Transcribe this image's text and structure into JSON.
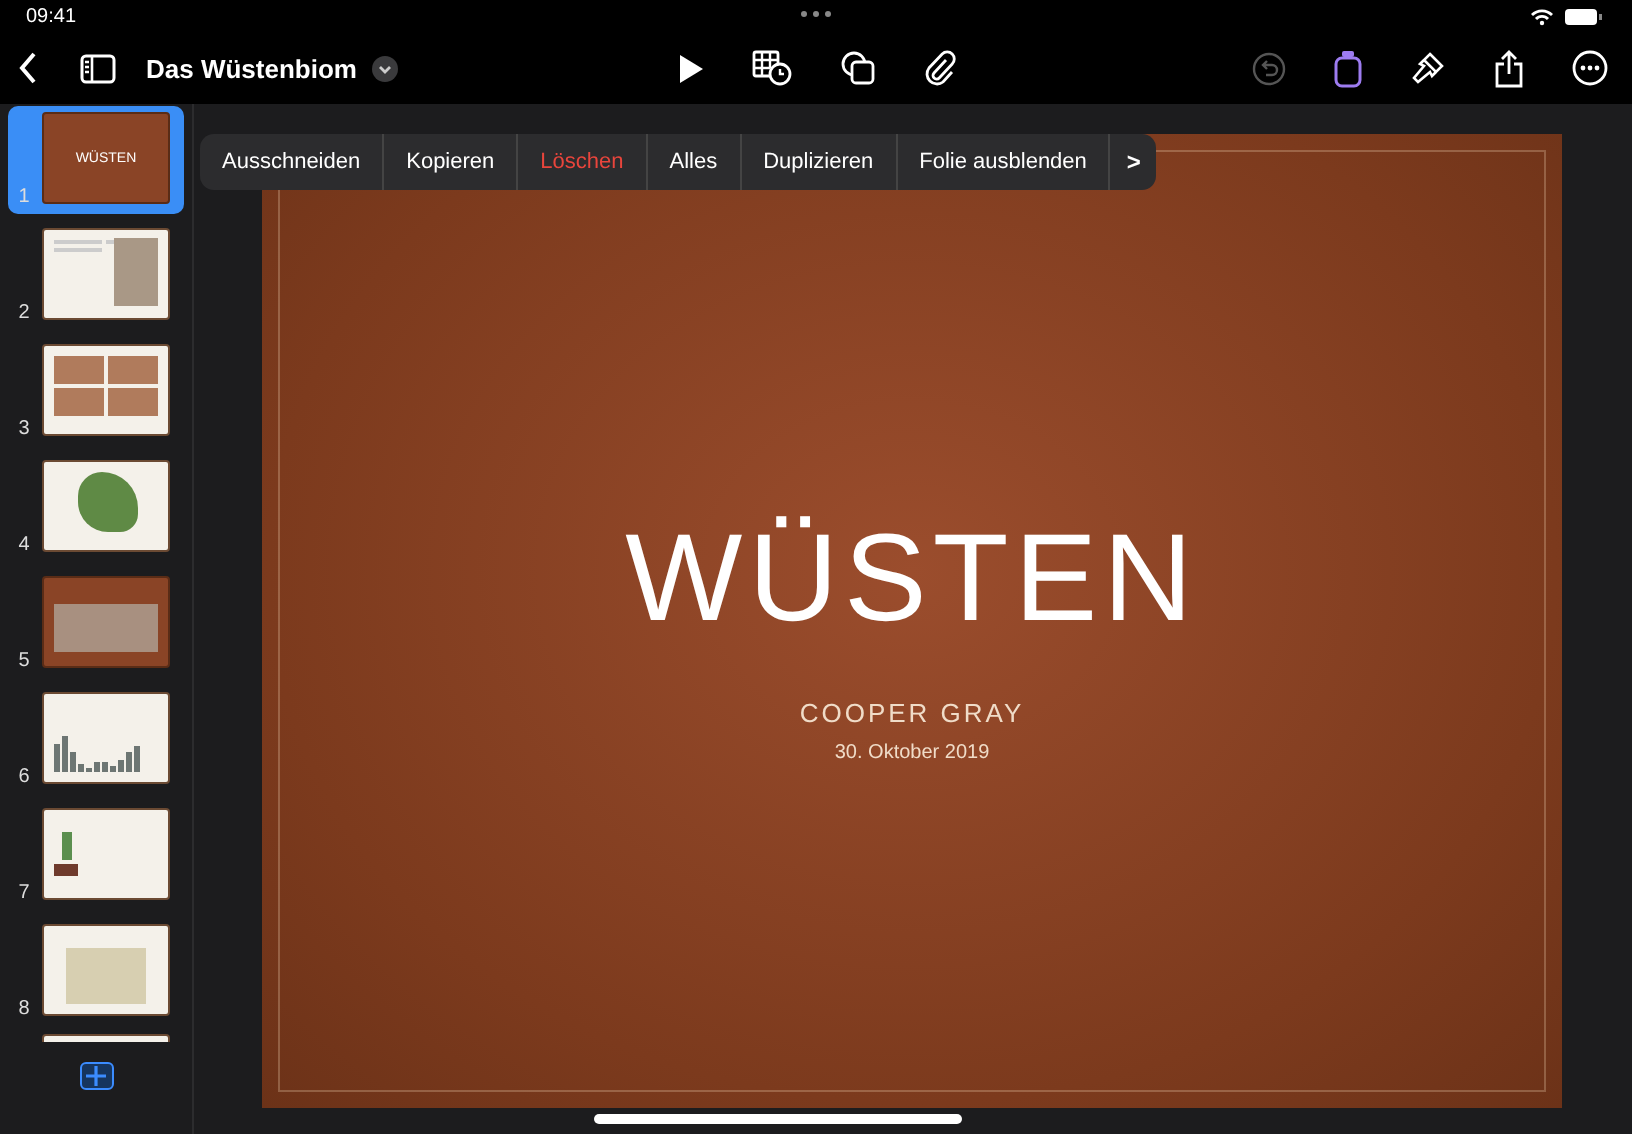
{
  "status_bar": {
    "time": "09:41"
  },
  "toolbar": {
    "title": "Das Wüstenbiom",
    "undo_disabled": true,
    "format_selected": true
  },
  "context_menu": {
    "items": [
      {
        "label": "Ausschneiden",
        "kind": "normal"
      },
      {
        "label": "Kopieren",
        "kind": "normal"
      },
      {
        "label": "Löschen",
        "kind": "destructive"
      },
      {
        "label": "Alles",
        "kind": "normal"
      },
      {
        "label": "Duplizieren",
        "kind": "normal"
      },
      {
        "label": "Folie ausblenden",
        "kind": "normal"
      },
      {
        "label": ">",
        "kind": "more"
      }
    ]
  },
  "slides": [
    {
      "number": "1",
      "selected": true,
      "kind": "title",
      "thumb_title": "WÜSTEN"
    },
    {
      "number": "2",
      "selected": false,
      "kind": "photo"
    },
    {
      "number": "3",
      "selected": false,
      "kind": "grid"
    },
    {
      "number": "4",
      "selected": false,
      "kind": "map"
    },
    {
      "number": "5",
      "selected": false,
      "kind": "brown"
    },
    {
      "number": "6",
      "selected": false,
      "kind": "chart"
    },
    {
      "number": "7",
      "selected": false,
      "kind": "illustration"
    },
    {
      "number": "8",
      "selected": false,
      "kind": "table"
    },
    {
      "selected": false,
      "kind": "partial"
    }
  ],
  "slide": {
    "title": "WÜSTEN",
    "author": "COOPER GRAY",
    "date": "30. Oktober 2019"
  }
}
